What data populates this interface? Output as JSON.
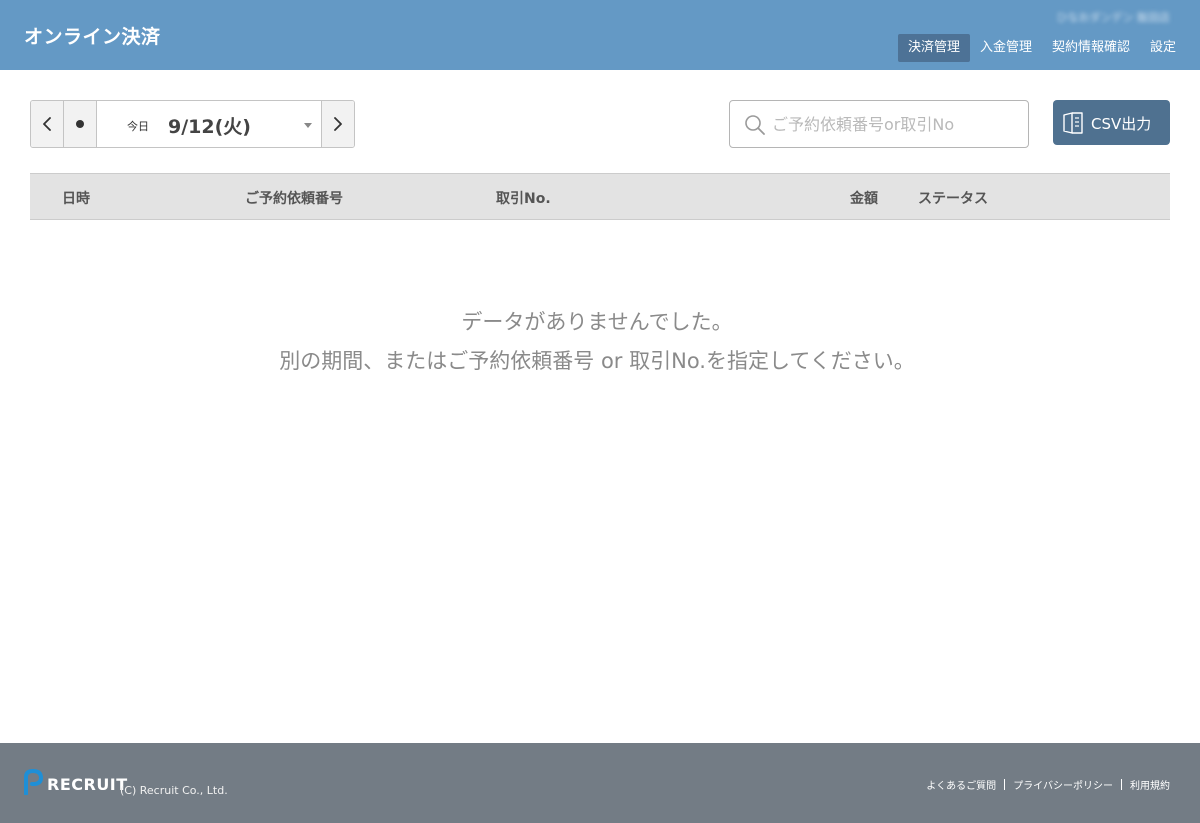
{
  "header": {
    "title": "オンライン決済",
    "store_name": "ひなおダンデン 飯田店",
    "nav": [
      {
        "label": "決済管理",
        "active": true
      },
      {
        "label": "入金管理",
        "active": false
      },
      {
        "label": "契約情報確認",
        "active": false
      },
      {
        "label": "設定",
        "active": false
      }
    ],
    "background_color": "#6499c5",
    "active_color": "#4d7296"
  },
  "toolbar": {
    "prev_icon": "chevron-left-icon",
    "today_icon": "dot-icon",
    "today_label": "今日",
    "date_value": "9/12(火)",
    "dropdown_icon": "caret-down-icon",
    "next_icon": "chevron-right-icon",
    "search_placeholder": "ご予約依頼番号or取引No",
    "search_value": "",
    "search_icon": "search-icon",
    "csv_label": "CSV出力",
    "csv_icon": "book-icon",
    "csv_color": "#4f7190"
  },
  "table": {
    "columns": [
      "日時",
      "ご予約依頼番号",
      "取引No.",
      "金額",
      "ステータス"
    ],
    "rows": []
  },
  "empty_message": {
    "line1": "データがありませんでした。",
    "line2": "別の期間、またはご予約依頼番号 or 取引No.を指定してください。"
  },
  "footer": {
    "logo_text": "RECRUIT",
    "copyright": "(C) Recruit Co., Ltd.",
    "links": [
      "よくあるご質問",
      "プライバシーポリシー",
      "利用規約"
    ],
    "background_color": "#737c85"
  }
}
